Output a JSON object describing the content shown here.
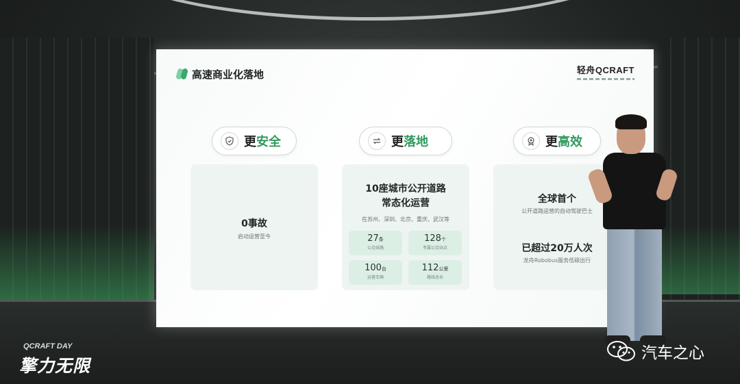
{
  "slide": {
    "title": "高速商业化落地",
    "brand": "轻舟QCRAFT"
  },
  "pills": [
    {
      "prefix": "更",
      "accent": "安全",
      "icon": "shield-icon"
    },
    {
      "prefix": "更",
      "accent": "落地",
      "icon": "route-icon"
    },
    {
      "prefix": "更",
      "accent": "高效",
      "icon": "medal-icon"
    }
  ],
  "cards": {
    "safety": {
      "headline": "0事故",
      "sub": "启动运营至今"
    },
    "landing": {
      "headline_1": "10座城市公开道路",
      "headline_2": "常态化运营",
      "cities": "在苏州、深圳、北京、重庆、武汉等",
      "stats": [
        {
          "value": "27",
          "unit": "条",
          "caption": "公交线路"
        },
        {
          "value": "128",
          "unit": "个",
          "caption": "专属公交站点"
        },
        {
          "value": "100",
          "unit": "台",
          "caption": "运营车辆"
        },
        {
          "value": "112",
          "unit": "公里",
          "caption": "路线总长"
        }
      ]
    },
    "efficiency": {
      "headline_1": "全球首个",
      "sub_1": "公开道路运营的自动驾驶巴士",
      "headline_2": "已超过20万人次",
      "sub_2": "龙舟Robobus服务低碳出行"
    }
  },
  "event": {
    "top": "QCRAFT DAY",
    "main": "擎力无限"
  },
  "watermark": {
    "text": "汽车之心"
  },
  "colors": {
    "accent": "#2f9a5e",
    "card": "#eef4f2",
    "stat": "#dcefe5"
  }
}
